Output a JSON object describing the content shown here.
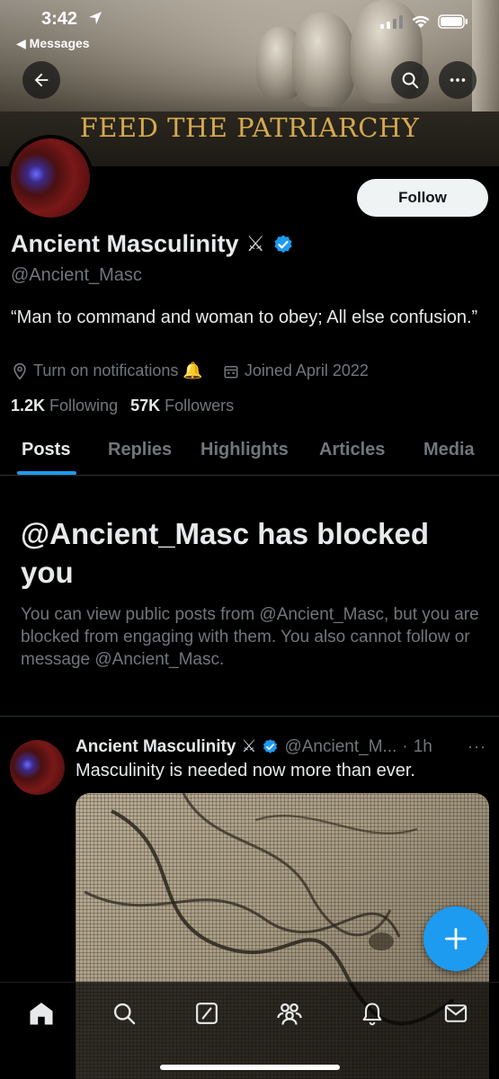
{
  "status_bar": {
    "time": "3:42",
    "back_app": "Messages"
  },
  "banner": {
    "title": "FEED THE PATRIARCHY"
  },
  "profile": {
    "name": "Ancient Masculinity",
    "name_emoji": "⚔",
    "handle": "@Ancient_Masc",
    "bio": "“Man to command and woman to obey; All else confusion.”",
    "notifications_label": "Turn on notifications",
    "notifications_emoji": "🔔",
    "joined": "Joined April 2022",
    "following_count": "1.2K",
    "following_label": "Following",
    "followers_count": "57K",
    "followers_label": "Followers",
    "follow_button": "Follow"
  },
  "tabs": [
    {
      "label": "Posts",
      "active": true
    },
    {
      "label": "Replies"
    },
    {
      "label": "Highlights"
    },
    {
      "label": "Articles"
    },
    {
      "label": "Media"
    }
  ],
  "blocked": {
    "title": "@Ancient_Masc has blocked you",
    "body": "You can view public posts from @Ancient_Masc, but you are blocked from engaging with them. You also cannot follow or message @Ancient_Masc."
  },
  "post": {
    "name": "Ancient Masculinity",
    "name_emoji": "⚔",
    "handle": "@Ancient_M...",
    "dot": "·",
    "time": "1h",
    "more": "···",
    "text": "Masculinity is needed now more than ever."
  },
  "colors": {
    "accent": "#1d9bf0",
    "verified": "#1d9bf0",
    "muted": "#71767b",
    "banner_title": "#d4a94f"
  },
  "icons": {
    "back": "arrow-left-icon",
    "search": "search-icon",
    "more": "more-icon",
    "compose": "plus-icon",
    "nav": [
      "home-icon",
      "search-icon",
      "grok-icon",
      "communities-icon",
      "bell-icon",
      "mail-icon"
    ]
  }
}
